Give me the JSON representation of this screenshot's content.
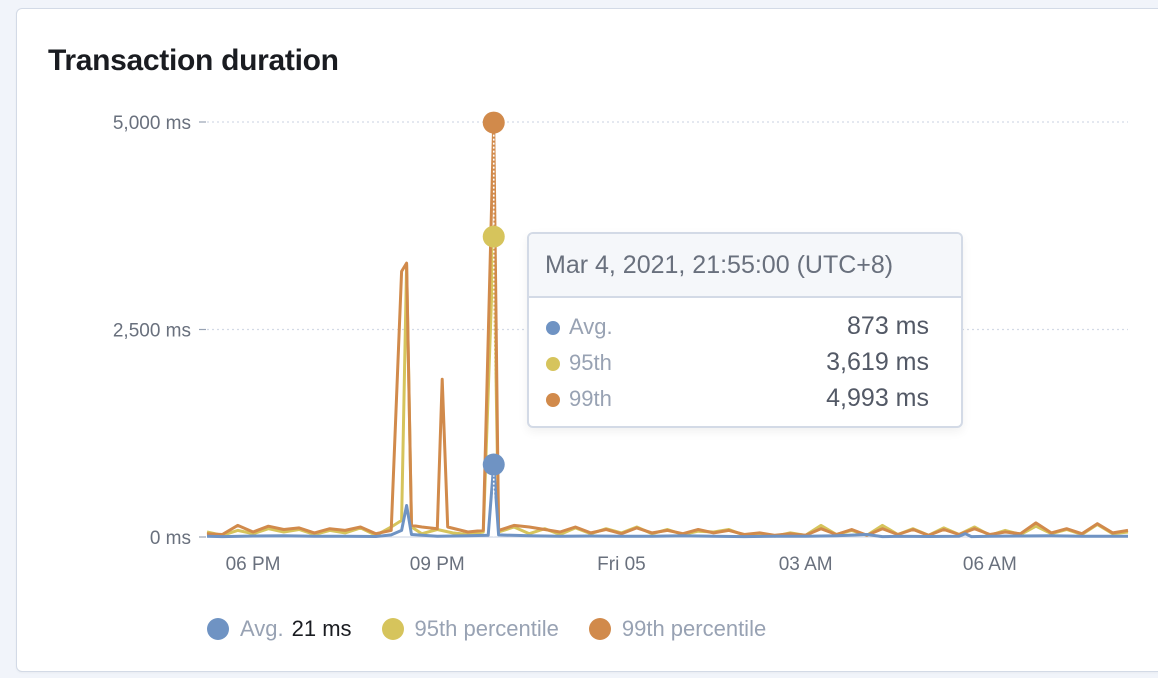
{
  "panel": {
    "title": "Transaction duration"
  },
  "colors": {
    "avg": "#6f93c3",
    "p95": "#d6c45c",
    "p99": "#d18a4b",
    "grid": "#d3dae6",
    "crosshair": "#ffffff"
  },
  "tooltip": {
    "header": "Mar 4, 2021, 21:55:00 (UTC+8)",
    "rows": [
      {
        "label": "Avg.",
        "value": "873 ms"
      },
      {
        "label": "95th",
        "value": "3,619 ms"
      },
      {
        "label": "99th",
        "value": "4,993 ms"
      }
    ]
  },
  "legend": {
    "items": [
      {
        "label": "Avg.",
        "value": "21 ms"
      },
      {
        "label": "95th percentile",
        "value": ""
      },
      {
        "label": "99th percentile",
        "value": ""
      }
    ]
  },
  "chart_data": {
    "type": "line",
    "title": "Transaction duration",
    "x_ticks": [
      "06 PM",
      "09 PM",
      "Fri 05",
      "03 AM",
      "06 AM"
    ],
    "x_tick_hours": [
      18,
      21,
      24,
      27,
      30
    ],
    "x_range_hours": [
      17.25,
      32.25
    ],
    "y_ticks": [
      "5,000 ms",
      "2,500 ms",
      "0 ms"
    ],
    "y_tick_values": [
      5000,
      2500,
      0
    ],
    "ylim": [
      0,
      5000
    ],
    "grid": true,
    "legend_position": "bottom",
    "highlight": {
      "time": "Mar 4, 2021, 21:55:00 (UTC+8)",
      "hour": 21.92,
      "avg": 873,
      "p95": 3619,
      "p99": 4993
    },
    "series": [
      {
        "name": "Avg.",
        "points": [
          [
            17.25,
            10
          ],
          [
            17.5,
            5
          ],
          [
            18,
            12
          ],
          [
            18.5,
            15
          ],
          [
            19,
            8
          ],
          [
            19.5,
            10
          ],
          [
            20,
            6
          ],
          [
            20.25,
            25
          ],
          [
            20.42,
            80
          ],
          [
            20.5,
            380
          ],
          [
            20.58,
            30
          ],
          [
            21,
            10
          ],
          [
            21.5,
            15
          ],
          [
            21.83,
            20
          ],
          [
            21.92,
            873
          ],
          [
            22,
            25
          ],
          [
            22.5,
            15
          ],
          [
            23,
            10
          ],
          [
            23.5,
            12
          ],
          [
            24,
            8
          ],
          [
            24.5,
            10
          ],
          [
            25,
            15
          ],
          [
            25.5,
            10
          ],
          [
            26,
            5
          ],
          [
            26.5,
            8
          ],
          [
            27,
            10
          ],
          [
            27.5,
            15
          ],
          [
            28,
            30
          ],
          [
            28.25,
            5
          ],
          [
            28.5,
            8
          ],
          [
            29,
            6
          ],
          [
            29.5,
            10
          ],
          [
            29.6,
            40
          ],
          [
            29.7,
            5
          ],
          [
            30,
            8
          ],
          [
            30.5,
            12
          ],
          [
            31,
            15
          ],
          [
            31.5,
            10
          ],
          [
            32,
            8
          ],
          [
            32.25,
            10
          ]
        ]
      },
      {
        "name": "95th percentile",
        "points": [
          [
            17.25,
            60
          ],
          [
            17.5,
            20
          ],
          [
            17.75,
            80
          ],
          [
            18,
            40
          ],
          [
            18.25,
            100
          ],
          [
            18.5,
            60
          ],
          [
            18.75,
            90
          ],
          [
            19,
            30
          ],
          [
            19.25,
            80
          ],
          [
            19.5,
            50
          ],
          [
            19.75,
            110
          ],
          [
            20,
            20
          ],
          [
            20.25,
            120
          ],
          [
            20.42,
            200
          ],
          [
            20.5,
            3280
          ],
          [
            20.58,
            120
          ],
          [
            20.75,
            40
          ],
          [
            21,
            90
          ],
          [
            21.25,
            50
          ],
          [
            21.5,
            30
          ],
          [
            21.75,
            60
          ],
          [
            21.92,
            3619
          ],
          [
            22,
            60
          ],
          [
            22.25,
            120
          ],
          [
            22.5,
            40
          ],
          [
            22.75,
            100
          ],
          [
            23,
            30
          ],
          [
            23.25,
            110
          ],
          [
            23.5,
            40
          ],
          [
            23.75,
            100
          ],
          [
            24,
            50
          ],
          [
            24.25,
            120
          ],
          [
            24.5,
            40
          ],
          [
            24.75,
            90
          ],
          [
            25,
            30
          ],
          [
            25.25,
            70
          ],
          [
            25.5,
            60
          ],
          [
            25.75,
            90
          ],
          [
            26,
            20
          ],
          [
            26.25,
            40
          ],
          [
            26.5,
            10
          ],
          [
            26.75,
            50
          ],
          [
            27,
            20
          ],
          [
            27.25,
            140
          ],
          [
            27.5,
            30
          ],
          [
            27.75,
            80
          ],
          [
            28,
            20
          ],
          [
            28.25,
            140
          ],
          [
            28.5,
            30
          ],
          [
            28.75,
            100
          ],
          [
            29,
            20
          ],
          [
            29.25,
            110
          ],
          [
            29.5,
            30
          ],
          [
            29.75,
            120
          ],
          [
            30,
            20
          ],
          [
            30.25,
            80
          ],
          [
            30.5,
            30
          ],
          [
            30.75,
            130
          ],
          [
            31,
            40
          ],
          [
            31.25,
            90
          ],
          [
            31.5,
            30
          ],
          [
            31.75,
            150
          ],
          [
            32,
            40
          ],
          [
            32.25,
            60
          ]
        ]
      },
      {
        "name": "99th percentile",
        "points": [
          [
            17.25,
            40
          ],
          [
            17.5,
            30
          ],
          [
            17.75,
            140
          ],
          [
            18,
            60
          ],
          [
            18.25,
            130
          ],
          [
            18.5,
            90
          ],
          [
            18.75,
            110
          ],
          [
            19,
            50
          ],
          [
            19.25,
            100
          ],
          [
            19.5,
            80
          ],
          [
            19.75,
            120
          ],
          [
            20,
            40
          ],
          [
            20.25,
            80
          ],
          [
            20.42,
            3200
          ],
          [
            20.5,
            3300
          ],
          [
            20.58,
            140
          ],
          [
            20.75,
            120
          ],
          [
            21,
            100
          ],
          [
            21.08,
            1900
          ],
          [
            21.17,
            120
          ],
          [
            21.5,
            60
          ],
          [
            21.75,
            80
          ],
          [
            21.92,
            4993
          ],
          [
            22,
            80
          ],
          [
            22.25,
            140
          ],
          [
            22.5,
            120
          ],
          [
            22.75,
            90
          ],
          [
            23,
            60
          ],
          [
            23.25,
            120
          ],
          [
            23.5,
            50
          ],
          [
            23.75,
            90
          ],
          [
            24,
            40
          ],
          [
            24.25,
            110
          ],
          [
            24.5,
            50
          ],
          [
            24.75,
            80
          ],
          [
            25,
            40
          ],
          [
            25.25,
            90
          ],
          [
            25.5,
            50
          ],
          [
            25.75,
            80
          ],
          [
            26,
            30
          ],
          [
            26.25,
            50
          ],
          [
            26.5,
            20
          ],
          [
            26.75,
            40
          ],
          [
            27,
            20
          ],
          [
            27.25,
            100
          ],
          [
            27.5,
            30
          ],
          [
            27.75,
            90
          ],
          [
            28,
            20
          ],
          [
            28.25,
            100
          ],
          [
            28.5,
            30
          ],
          [
            28.75,
            90
          ],
          [
            29,
            20
          ],
          [
            29.25,
            90
          ],
          [
            29.5,
            30
          ],
          [
            29.75,
            100
          ],
          [
            30,
            30
          ],
          [
            30.25,
            60
          ],
          [
            30.5,
            40
          ],
          [
            30.75,
            170
          ],
          [
            31,
            50
          ],
          [
            31.25,
            100
          ],
          [
            31.5,
            40
          ],
          [
            31.75,
            160
          ],
          [
            32,
            50
          ],
          [
            32.25,
            80
          ]
        ]
      }
    ]
  }
}
